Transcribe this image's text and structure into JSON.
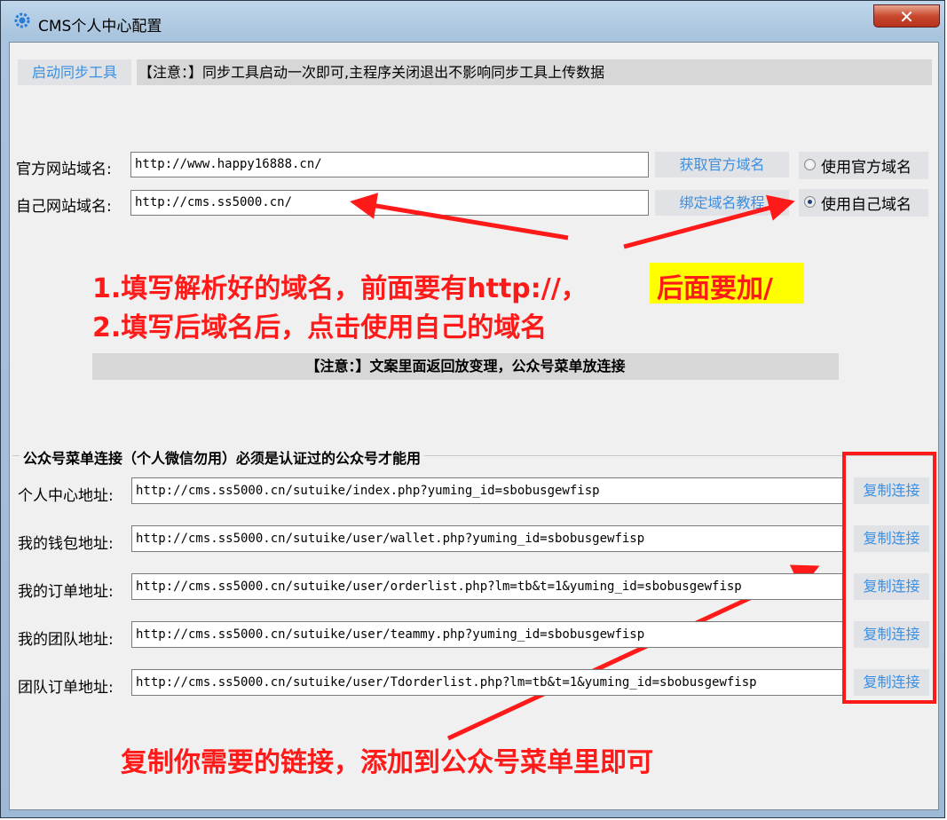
{
  "window": {
    "title": "CMS个人中心配置",
    "close_symbol": "✕"
  },
  "top": {
    "start_sync_button": "启动同步工具",
    "notice": "【注意：】同步工具启动一次即可,主程序关闭退出不影响同步工具上传数据"
  },
  "domain": {
    "official_label": "官方网站域名:",
    "official_value": "http://www.happy16888.cn/",
    "get_official_button": "获取官方域名",
    "use_official_label": "使用官方域名",
    "own_label": "自己网站域名:",
    "own_value": "http://cms.ss5000.cn/",
    "bind_tutorial_button": "绑定域名教程",
    "use_own_label": "使用自己域名",
    "selected": "own"
  },
  "annotations": {
    "step1_prefix": "1.填写解析好的域名，前面要有http://，",
    "step1_highlight": "后面要加/",
    "step2": "2.填写后域名后，点击使用自己的域名",
    "copy_hint": "复制你需要的链接，添加到公众号菜单里即可"
  },
  "notice2": "【注意：】文案里面返回放变理，公众号菜单放连接",
  "menu_links": {
    "group_title": "公众号菜单连接（个人微信勿用）必须是认证过的公众号才能用",
    "copy_label": "复制连接",
    "rows": [
      {
        "label": "个人中心地址:",
        "url": "http://cms.ss5000.cn/sutuike/index.php?yuming_id=sbobusgewfisp"
      },
      {
        "label": "我的钱包地址:",
        "url": "http://cms.ss5000.cn/sutuike/user/wallet.php?yuming_id=sbobusgewfisp"
      },
      {
        "label": "我的订单地址:",
        "url": "http://cms.ss5000.cn/sutuike/user/orderlist.php?lm=tb&t=1&yuming_id=sbobusgewfisp"
      },
      {
        "label": "我的团队地址:",
        "url": "http://cms.ss5000.cn/sutuike/user/teammy.php?yuming_id=sbobusgewfisp"
      },
      {
        "label": "团队订单地址:",
        "url": "http://cms.ss5000.cn/sutuike/user/Tdorderlist.php?lm=tb&t=1&yuming_id=sbobusgewfisp"
      }
    ]
  },
  "colors": {
    "annotation_red": "#ff1a1a",
    "highlight_yellow": "#ffff00",
    "link_blue": "#3b8fe0"
  },
  "icons": {
    "app": "gear-icon",
    "close": "close-icon"
  }
}
